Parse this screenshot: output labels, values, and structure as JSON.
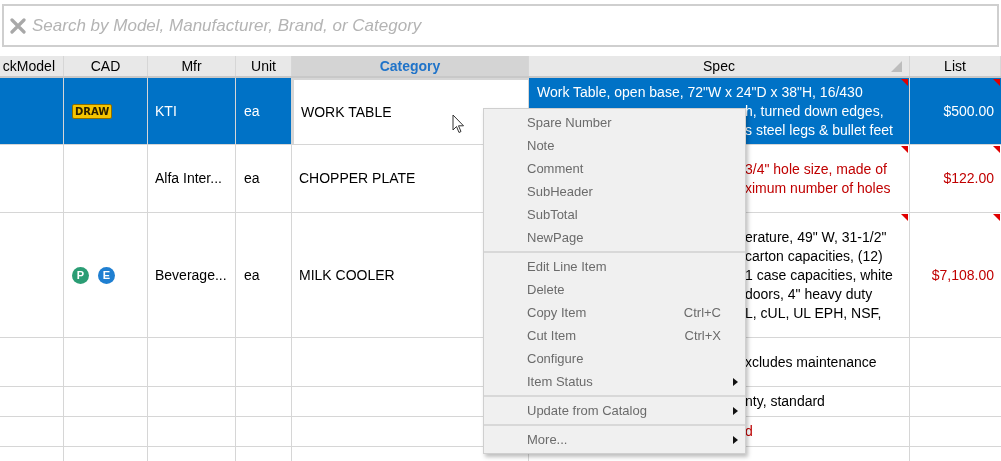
{
  "search": {
    "placeholder": "Search by Model, Manufacturer, Brand, or Category"
  },
  "table": {
    "columns": [
      {
        "label": "ckModel",
        "selected": false
      },
      {
        "label": "CAD",
        "selected": false
      },
      {
        "label": "Mfr",
        "selected": false
      },
      {
        "label": "Unit",
        "selected": false
      },
      {
        "label": "Category",
        "selected": true
      },
      {
        "label": "Spec",
        "selected": false,
        "sorted": true
      },
      {
        "label": "List",
        "selected": false
      }
    ],
    "rows": [
      {
        "selected": true,
        "marked": true,
        "cad": [
          {
            "kind": "draw",
            "text": "DRAW"
          }
        ],
        "mfr": "KTI",
        "unit": "ea",
        "category": "WORK TABLE",
        "spec": [
          "Work Table, open base, 72\"W x 24\"D x 38\"H, 16/430",
          "h, turned down edges,",
          "s steel legs & bullet feet"
        ],
        "spec_flagged": false,
        "list": "$500.00",
        "list_flagged": false
      },
      {
        "selected": false,
        "marked": true,
        "cad": [],
        "mfr": "Alfa Inter...",
        "unit": "ea",
        "category": "CHOPPER PLATE",
        "spec": [
          "3/4\" hole size, made of",
          "ximum number of holes"
        ],
        "spec_flagged": true,
        "list": "$122.00",
        "list_flagged": true
      },
      {
        "selected": false,
        "marked": true,
        "cad": [
          {
            "kind": "circle",
            "text": "P",
            "color": "#2a9d74"
          },
          {
            "kind": "circle",
            "text": "E",
            "color": "#1f7fd1"
          }
        ],
        "mfr": "Beverage...",
        "unit": "ea",
        "category": "MILK COOLER",
        "spec": [
          "erature, 49\" W, 31-1/2\"",
          "carton capacities, (12)",
          "1 case capacities, white",
          "doors, 4\" heavy duty",
          "L, cUL, UL EPH, NSF,"
        ],
        "spec_flagged": false,
        "list": "$7,108.00",
        "list_flagged": true
      },
      {
        "selected": false,
        "marked": false,
        "cad": [],
        "spec": [
          "xcludes maintenance"
        ],
        "spec_flagged": false
      },
      {
        "selected": false,
        "marked": false,
        "cad": [],
        "spec": [
          "nty, standard"
        ],
        "spec_flagged": false
      },
      {
        "selected": false,
        "marked": false,
        "cad": [],
        "spec": [
          "d"
        ],
        "spec_flagged": true
      },
      {
        "selected": false,
        "marked": false,
        "cad": []
      }
    ]
  },
  "context_menu": {
    "items": [
      {
        "label": "Spare Number",
        "separator_before": false,
        "submenu": false
      },
      {
        "label": "Note",
        "separator_before": false,
        "submenu": false
      },
      {
        "label": "Comment",
        "separator_before": false,
        "submenu": false
      },
      {
        "label": "SubHeader",
        "separator_before": false,
        "submenu": false
      },
      {
        "label": "SubTotal",
        "separator_before": false,
        "submenu": false
      },
      {
        "label": "NewPage",
        "separator_before": false,
        "submenu": false
      },
      {
        "label": "Edit Line Item",
        "separator_before": true,
        "submenu": false
      },
      {
        "label": "Delete",
        "separator_before": false,
        "submenu": false
      },
      {
        "label": "Copy Item",
        "shortcut": "Ctrl+C",
        "separator_before": false,
        "submenu": false
      },
      {
        "label": "Cut Item",
        "shortcut": "Ctrl+X",
        "separator_before": false,
        "submenu": false
      },
      {
        "label": "Configure",
        "separator_before": false,
        "submenu": false
      },
      {
        "label": "Item Status",
        "separator_before": false,
        "submenu": true
      },
      {
        "label": "Update from Catalog",
        "separator_before": true,
        "submenu": true
      },
      {
        "label": "More...",
        "separator_before": true,
        "submenu": true
      }
    ]
  }
}
